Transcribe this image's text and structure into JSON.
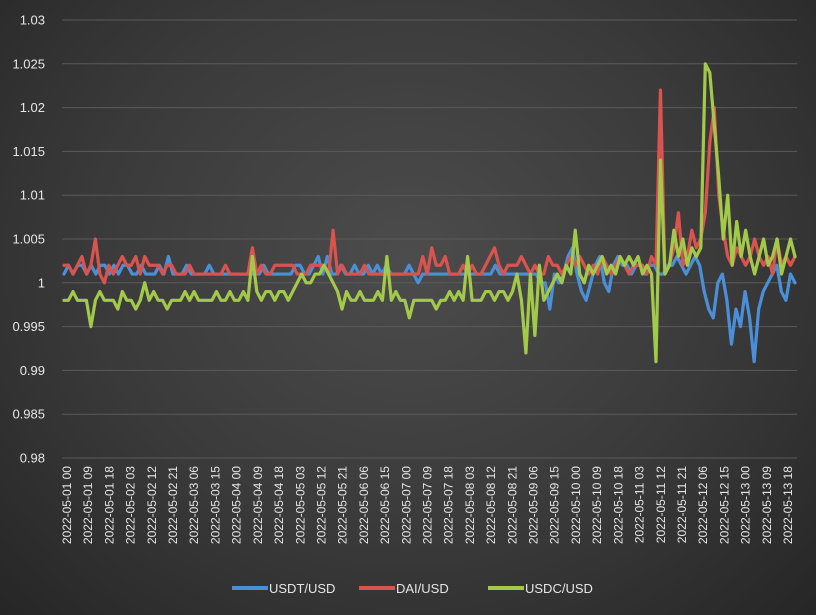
{
  "chart_data": {
    "type": "line",
    "title": "",
    "xlabel": "",
    "ylabel": "",
    "ylim": [
      0.98,
      1.03
    ],
    "grid": true,
    "legend_position": "bottom",
    "yticks": [
      "1.03",
      "1.025",
      "1.02",
      "1.015",
      "1.01",
      "1.005",
      "1",
      "0.995",
      "0.99",
      "0.985",
      "0.98"
    ],
    "x_tick_labels": [
      "2022-05-01 00",
      "2022-05-01 09",
      "2022-05-01 18",
      "2022-05-02 03",
      "2022-05-02 12",
      "2022-05-02 21",
      "2022-05-03 06",
      "2022-05-03 15",
      "2022-05-04 00",
      "2022-05-04 09",
      "2022-05-04 18",
      "2022-05-05 03",
      "2022-05-05 12",
      "2022-05-05 21",
      "2022-05-06 06",
      "2022-05-06 15",
      "2022-05-07 00",
      "2022-05-07 09",
      "2022-05-07 18",
      "2022-05-08 03",
      "2022-05-08 12",
      "2022-05-08 21",
      "2022-05-09 06",
      "2022-05-09 15",
      "2022-05-10 00",
      "2022-05-10 09",
      "2022-05-10 18",
      "2022-05-11 03",
      "2022-05-11 12",
      "2022-05-11 21",
      "2022-05-12 06",
      "2022-05-12 15",
      "2022-05-13 00",
      "2022-05-13 09",
      "2022-05-13 18"
    ],
    "series": [
      {
        "name": "USDT/USD",
        "color": "#4a90d9",
        "values": [
          1.001,
          1.002,
          1.001,
          1.002,
          1.002,
          1.001,
          1.002,
          1.001,
          1.002,
          1.002,
          1.001,
          1.002,
          1.001,
          1.002,
          1.002,
          1.001,
          1.001,
          1.002,
          1.001,
          1.001,
          1.001,
          1.002,
          1.001,
          1.003,
          1.001,
          1.001,
          1.001,
          1.002,
          1.001,
          1.001,
          1.001,
          1.001,
          1.002,
          1.001,
          1.001,
          1.001,
          1.001,
          1.001,
          1.001,
          1.001,
          1.001,
          1.001,
          1.001,
          1.001,
          1.002,
          1.001,
          1.001,
          1.001,
          1.001,
          1.001,
          1.001,
          1.002,
          1.002,
          1.001,
          1.001,
          1.002,
          1.003,
          1.001,
          1.003,
          1.001,
          1.001,
          1.002,
          1.001,
          1.001,
          1.002,
          1.001,
          1.001,
          1.002,
          1.001,
          1.002,
          1.001,
          1.002,
          1.001,
          1.001,
          1.001,
          1.001,
          1.002,
          1.001,
          1.0,
          1.001,
          1.001,
          1.001,
          1.001,
          1.001,
          1.001,
          1.001,
          1.001,
          1.001,
          1.001,
          1.001,
          1.001,
          1.001,
          1.001,
          1.001,
          1.001,
          1.002,
          1.001,
          1.001,
          1.001,
          1.001,
          1.001,
          1.001,
          1.001,
          1.001,
          1.001,
          1.0,
          1.0,
          0.997,
          1.001,
          1.0,
          1.001,
          1.003,
          1.004,
          1.001,
          0.999,
          0.998,
          1.0,
          1.002,
          1.003,
          1.0,
          0.999,
          1.002,
          1.003,
          1.002,
          1.002,
          1.001,
          1.002,
          1.002,
          1.001,
          1.002,
          1.002,
          1.001,
          1.001,
          1.002,
          1.002,
          1.003,
          1.002,
          1.001,
          1.002,
          1.003,
          1.002,
          0.999,
          0.997,
          0.996,
          1.0,
          1.001,
          0.998,
          0.993,
          0.997,
          0.995,
          0.999,
          0.996,
          0.991,
          0.997,
          0.999,
          1.0,
          1.001,
          1.002,
          0.999,
          0.998,
          1.001,
          1.0
        ]
      },
      {
        "name": "DAI/USD",
        "color": "#d9534f",
        "values": [
          1.002,
          1.002,
          1.001,
          1.002,
          1.003,
          1.001,
          1.002,
          1.005,
          1.001,
          1.0,
          1.002,
          1.001,
          1.002,
          1.003,
          1.002,
          1.002,
          1.003,
          1.001,
          1.003,
          1.002,
          1.002,
          1.002,
          1.001,
          1.002,
          1.002,
          1.001,
          1.001,
          1.001,
          1.002,
          1.001,
          1.001,
          1.001,
          1.001,
          1.001,
          1.001,
          1.001,
          1.002,
          1.001,
          1.001,
          1.001,
          1.001,
          1.001,
          1.004,
          1.001,
          1.002,
          1.001,
          1.001,
          1.002,
          1.002,
          1.002,
          1.002,
          1.002,
          1.001,
          1.001,
          1.001,
          1.002,
          1.002,
          1.002,
          1.002,
          1.001,
          1.006,
          1.001,
          1.002,
          1.001,
          1.001,
          1.001,
          1.001,
          1.002,
          1.001,
          1.001,
          1.001,
          1.001,
          1.001,
          1.001,
          1.001,
          1.001,
          1.001,
          1.001,
          1.001,
          1.001,
          1.003,
          1.001,
          1.004,
          1.002,
          1.002,
          1.003,
          1.001,
          1.001,
          1.001,
          1.002,
          1.001,
          1.002,
          1.001,
          1.001,
          1.002,
          1.003,
          1.004,
          1.002,
          1.001,
          1.002,
          1.002,
          1.002,
          1.003,
          1.002,
          1.001,
          1.002,
          1.001,
          1.001,
          1.003,
          1.002,
          1.002,
          1.001,
          1.002,
          1.003,
          1.002,
          1.003,
          1.002,
          1.001,
          1.002,
          1.001,
          1.003,
          1.002,
          1.001,
          1.002,
          1.003,
          1.002,
          1.001,
          1.002,
          1.002,
          1.002,
          1.001,
          1.003,
          1.002,
          1.022,
          1.001,
          1.002,
          1.004,
          1.008,
          1.002,
          1.003,
          1.006,
          1.004,
          1.005,
          1.008,
          1.016,
          1.02,
          1.01,
          1.006,
          1.003,
          1.002,
          1.004,
          1.003,
          1.002,
          1.003,
          1.005,
          1.003,
          1.002,
          1.003,
          1.001,
          1.005,
          1.002,
          1.003,
          1.002,
          1.003
        ]
      },
      {
        "name": "USDC/USD",
        "color": "#a3c94a",
        "values": [
          0.998,
          0.998,
          0.999,
          0.998,
          0.998,
          0.998,
          0.995,
          0.998,
          0.999,
          0.998,
          0.998,
          0.998,
          0.997,
          0.999,
          0.998,
          0.998,
          0.997,
          0.998,
          1.0,
          0.998,
          0.999,
          0.998,
          0.998,
          0.997,
          0.998,
          0.998,
          0.998,
          0.999,
          0.998,
          0.999,
          0.998,
          0.998,
          0.998,
          0.998,
          0.999,
          0.998,
          0.998,
          0.999,
          0.998,
          0.998,
          0.999,
          0.998,
          1.003,
          0.999,
          0.998,
          0.999,
          0.999,
          0.998,
          0.999,
          0.999,
          0.998,
          0.999,
          1.0,
          1.001,
          1.0,
          1.0,
          1.001,
          1.001,
          1.002,
          1.001,
          1.0,
          0.999,
          0.997,
          0.999,
          0.998,
          0.998,
          0.999,
          0.998,
          0.998,
          0.998,
          0.999,
          0.998,
          1.003,
          0.998,
          0.999,
          0.998,
          0.998,
          0.996,
          0.998,
          0.998,
          0.998,
          0.998,
          0.998,
          0.997,
          0.998,
          0.998,
          0.999,
          0.998,
          0.999,
          0.998,
          1.003,
          0.998,
          0.998,
          0.998,
          0.999,
          0.999,
          0.998,
          0.999,
          0.999,
          0.998,
          0.999,
          1.001,
          0.998,
          0.992,
          1.001,
          0.994,
          1.002,
          0.998,
          0.999,
          1.0,
          1.001,
          1.0,
          1.002,
          1.001,
          1.006,
          1.001,
          1.0,
          1.002,
          1.001,
          1.002,
          1.003,
          1.001,
          1.002,
          1.001,
          1.003,
          1.002,
          1.003,
          1.002,
          1.003,
          1.001,
          1.002,
          1.001,
          0.991,
          1.014,
          1.001,
          1.002,
          1.006,
          1.003,
          1.005,
          1.002,
          1.004,
          1.003,
          1.004,
          1.025,
          1.024,
          1.018,
          1.012,
          1.005,
          1.01,
          1.002,
          1.007,
          1.003,
          1.006,
          1.003,
          1.001,
          1.003,
          1.005,
          1.002,
          1.003,
          1.005,
          1.001,
          1.003,
          1.005,
          1.003
        ]
      }
    ]
  }
}
